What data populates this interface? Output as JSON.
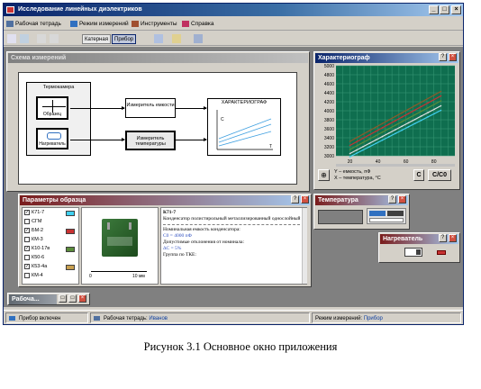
{
  "window": {
    "title": "Исследование линейных диэлектриков"
  },
  "menu": {
    "items": [
      {
        "label": "Рабочая тетрадь",
        "icon": "notebook-icon"
      },
      {
        "label": "Режим измерений",
        "icon": "measure-icon"
      },
      {
        "label": "Инструменты",
        "icon": "tools-icon"
      },
      {
        "label": "Справка",
        "icon": "help-icon"
      }
    ]
  },
  "toolbar": {
    "katernaya": "Катерная",
    "pribor": "Прибор"
  },
  "scheme": {
    "title": "Схема измерений",
    "thermostat": "Термокамера",
    "sample": "Образец",
    "heater": "Нагреватель",
    "cap_meter": "Измеритель емкости",
    "temp_meter": "Измеритель температуры",
    "graph": "ХАРАКТЕРИОГРАФ",
    "graph_ylabel": "C",
    "graph_xlabel": "T"
  },
  "chart_window": {
    "title": "Характериограф",
    "legend_y": "Y – емкость, пФ",
    "legend_x": "X – температура, °С",
    "btn_c": "С",
    "btn_c0": "С/С0",
    "zoom_icon": "magnifier-icon"
  },
  "chart_data": {
    "type": "line",
    "yticks": [
      "5000",
      "4800",
      "4600",
      "4400",
      "4200",
      "4000",
      "3800",
      "3600",
      "3400",
      "3200",
      "3000"
    ],
    "xticks": [
      "20",
      "40",
      "60",
      "80"
    ],
    "xlim": [
      10,
      95
    ],
    "ylim": [
      3000,
      5000
    ],
    "series": [
      {
        "color": "#8b5a2b",
        "x": [
          20,
          85
        ],
        "y": [
          3320,
          4430
        ]
      },
      {
        "color": "#c83232",
        "x": [
          20,
          85
        ],
        "y": [
          3230,
          4330
        ]
      },
      {
        "color": "#5a8c3a",
        "x": [
          20,
          85
        ],
        "y": [
          3140,
          4220
        ]
      },
      {
        "color": "#e0e0e0",
        "x": [
          20,
          85
        ],
        "y": [
          3050,
          4110
        ]
      },
      {
        "color": "#40d0f0",
        "x": [
          20,
          85
        ],
        "y": [
          2980,
          4010
        ]
      }
    ],
    "grid": true,
    "background": "#0f6e4f"
  },
  "temperature": {
    "title": "Температура"
  },
  "heater_win": {
    "title": "Нагреватель"
  },
  "params": {
    "title": "Параметры образца",
    "items": [
      {
        "label": "К71-7",
        "checked": true,
        "color": "#40d0f0"
      },
      {
        "label": "СГМ",
        "checked": false,
        "color": "#ffffff"
      },
      {
        "label": "БМ-2",
        "checked": true,
        "color": "#c83232"
      },
      {
        "label": "КМ-3",
        "checked": false,
        "color": "#ffffff"
      },
      {
        "label": "К10-17в",
        "checked": true,
        "color": "#5a8c3a"
      },
      {
        "label": "К50-6",
        "checked": false,
        "color": "#ffffff"
      },
      {
        "label": "К53-4а",
        "checked": true,
        "color": "#c8a050"
      },
      {
        "label": "КМ-4",
        "checked": false,
        "color": "#ffffff"
      }
    ],
    "scale_left": "0",
    "scale_right": "10 мм",
    "desc_title": "К71-7",
    "desc_type": "Конденсатор полистирольный металлизированный однослойный",
    "desc_nom_label": "Номинальная емкость конденсатора:",
    "desc_nom_value": "C0 = 4000 пФ",
    "desc_dev_label": "Допустимые отклонения от номинала:",
    "desc_dev_value": "ΔC = 5%",
    "desc_tkc": "Группа по ТКЕ:"
  },
  "minimized": {
    "title": "Рабоча..."
  },
  "status": {
    "device": "Прибор включен",
    "workbook_label": "Рабочая тетрадь:",
    "workbook_value": "Иванов",
    "mode_label": "Режим измерений:",
    "mode_value": "Прибор"
  },
  "caption": "Рисунок 3.1  Основное окно приложения"
}
